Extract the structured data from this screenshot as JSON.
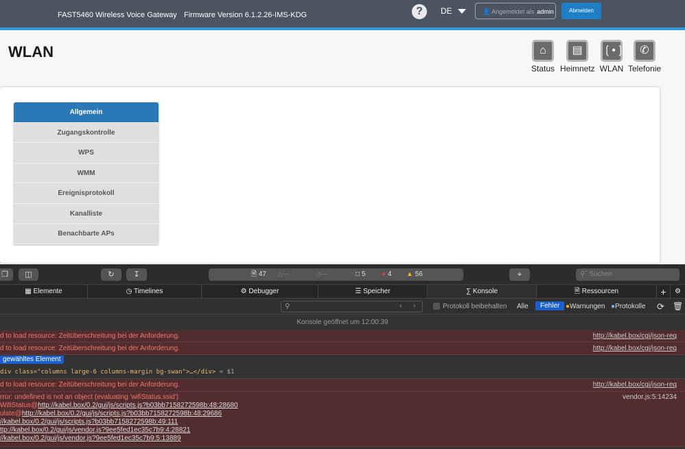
{
  "header": {
    "device": "FAST5460 Wireless Voice Gateway",
    "firmware": "Firmware Version 6.1.2.26-IMS-KDG",
    "help": "?",
    "language": "DE",
    "logged_in_label": "Angemeldet als",
    "user": "admin",
    "logout": "Abmelden"
  },
  "page": {
    "title": "WLAN"
  },
  "nav": [
    {
      "label": "Status",
      "icon": "home-icon"
    },
    {
      "label": "Heimnetz",
      "icon": "router-icon"
    },
    {
      "label": "WLAN",
      "icon": "wifi-antenna-icon"
    },
    {
      "label": "Telefonie",
      "icon": "phone-icon"
    }
  ],
  "menu": {
    "items": [
      "Allgemein",
      "Zugangskontrolle",
      "WPS",
      "WMM",
      "Ereignisprotokoll",
      "Kanalliste",
      "Benachbarte APs"
    ],
    "active": "Allgemein"
  },
  "devtools": {
    "toolbar": {
      "resources": "47",
      "logs": "5",
      "errors": "4",
      "warnings": "56",
      "dash1": "—",
      "dash2": "—",
      "search_placeholder": "Suchen"
    },
    "tabs": [
      "Elemente",
      "Timelines",
      "Debugger",
      "Speicher",
      "Konsole",
      "Ressourcen"
    ],
    "filter": {
      "preserve_log": "Protokoll beibehalten",
      "all": "Alle",
      "errors": "Fehler",
      "warnings": "Warnungen",
      "logs": "Protokolle"
    },
    "console": {
      "opened": "Konsole geöffnet um 12:00:39",
      "msg1": "d to load resource: Zeitüberschreitung bei der Anforderung.",
      "url": "http://kabel.box/cgi/json-req",
      "selected_badge": "gewähltes Element",
      "selected_html": "div class=\"columns large-6 columns-margin bg-swan\">…</div>",
      "selected_ref": "= $1",
      "error_title": "rror: undefined is not an object (evaluating 'wifiStatus.ssid')",
      "error_source": "vendor.js:5:14234",
      "stack": [
        {
          "prefix": "WifiStatus@",
          "url": "http://kabel.box/0.2/gui/js/scripts.js?b03bb7158272598b:48:28680"
        },
        {
          "prefix": "ulate@",
          "url": "http://kabel.box/0.2/gui/js/scripts.js?b03bb7158272598b:48:29686"
        },
        {
          "prefix": "",
          "url": "//kabel.box/0.2/gui/js/scripts.js?b03bb7158272598b:49:111"
        },
        {
          "prefix": "",
          "url": "ttp://kabel.box/0.2/gui/js/vendor.js?9ee5fed1ec35c7b9:4:28821"
        },
        {
          "prefix": "",
          "url": "//kabel.box/0.2/gui/js/vendor.js?9ee5fed1ec35c7b9:5:13889"
        }
      ]
    }
  }
}
